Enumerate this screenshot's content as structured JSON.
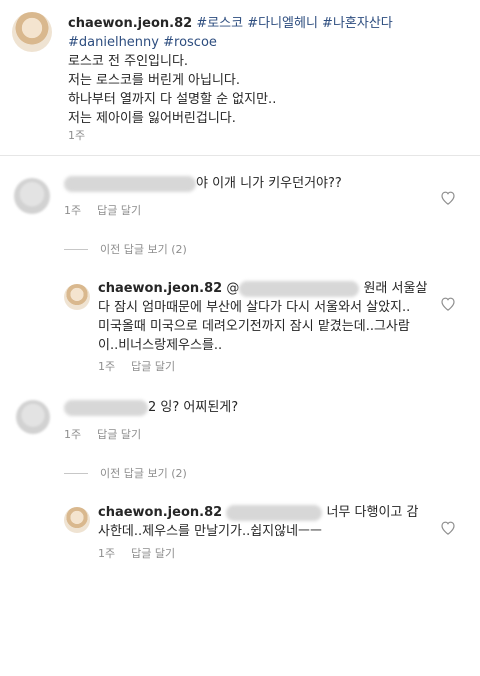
{
  "post": {
    "username": "chaewon.jeon.82",
    "hashtags": "#로스코 #다니엘헤니 #나혼자산다",
    "hashtags2": "#danielhenny #roscoe",
    "lines": [
      "로스코 전 주인입니다.",
      "저는 로스코를 버린게 아닙니다.",
      "하나부터 열까지 다 설명할 순 없지만..",
      "저는 제아이를 잃어버린겁니다."
    ],
    "time": "1주"
  },
  "comments": [
    {
      "text": "야 이개 니가 키우던거야??",
      "time": "1주",
      "reply_label": "답글 달기",
      "view_replies": "이전 답글 보기 (2)"
    },
    {
      "username": "chaewon.jeon.82",
      "text_line1": "원래 서울살",
      "text_line2": "다 잠시 엄마때문에 부산에 살다가 다시 서울와서 살았지..",
      "text_line3": "미국올때 미국으로 데려오기전까지 잠시 맡겼는데..그사람",
      "text_line4": "이..비너스랑제우스를..",
      "mention_prefix": "@",
      "time": "1주",
      "reply_label": "답글 달기"
    },
    {
      "text": "2 잉? 어찌된게?",
      "time": "1주",
      "reply_label": "답글 달기",
      "view_replies": "이전 답글 보기 (2)"
    },
    {
      "username": "chaewon.jeon.82",
      "text_line1": "너무 다행이고 감",
      "text_line2": "사한데..제우스를 만날기가..쉽지않네ㅡㅡ",
      "time": "1주",
      "reply_label": "답글 달기"
    }
  ],
  "icons": {
    "heart": "heart-outline-icon"
  },
  "colors": {
    "hashtag": "#2d4d7f",
    "meta": "#8e8e8e"
  }
}
